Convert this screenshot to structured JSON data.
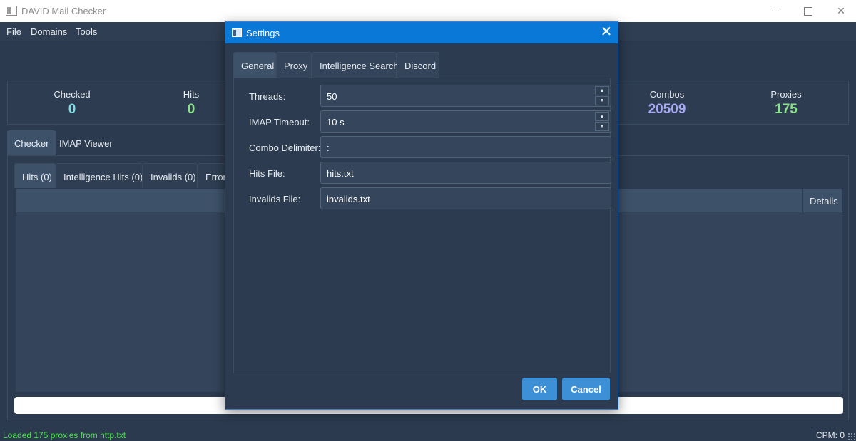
{
  "window": {
    "title": "DAVID Mail Checker",
    "icon": "app-window-icon"
  },
  "menu": {
    "file": "File",
    "domains": "Domains",
    "tools": "Tools"
  },
  "stats": {
    "checked": {
      "label": "Checked",
      "value": "0",
      "color": "#7fdbe4"
    },
    "hits": {
      "label": "Hits",
      "value": "0",
      "color": "#8be28b"
    },
    "combos": {
      "label": "Combos",
      "value": "20509",
      "color": "#a7a8f2"
    },
    "proxies": {
      "label": "Proxies",
      "value": "175",
      "color": "#8be28b"
    }
  },
  "outer_tabs": {
    "checker": "Checker",
    "imap_viewer": "IMAP Viewer"
  },
  "inner_tabs": {
    "hits": "Hits (0)",
    "intelligence_hits": "Intelligence Hits (0)",
    "invalids": "Invalids (0)",
    "errors": "Errors"
  },
  "table": {
    "details_header": "Details"
  },
  "statusbar": {
    "message": "Loaded 175 proxies from http.txt",
    "cpm": "CPM: 0"
  },
  "dialog": {
    "title": "Settings",
    "close_glyph": "✕",
    "tabs": {
      "general": "General",
      "proxy": "Proxy",
      "intelligence_search": "Intelligence Search",
      "discord": "Discord"
    },
    "fields": {
      "threads": {
        "label": "Threads:",
        "value": "50"
      },
      "imap_timeout": {
        "label": "IMAP Timeout:",
        "value": "10 s"
      },
      "combo_delimiter": {
        "label": "Combo Delimiter:",
        "value": ":"
      },
      "hits_file": {
        "label": "Hits File:",
        "value": "hits.txt"
      },
      "invalids_file": {
        "label": "Invalids File:",
        "value": "invalids.txt"
      }
    },
    "spin_up": "▲",
    "spin_down": "▼",
    "ok": "OK",
    "cancel": "Cancel"
  }
}
